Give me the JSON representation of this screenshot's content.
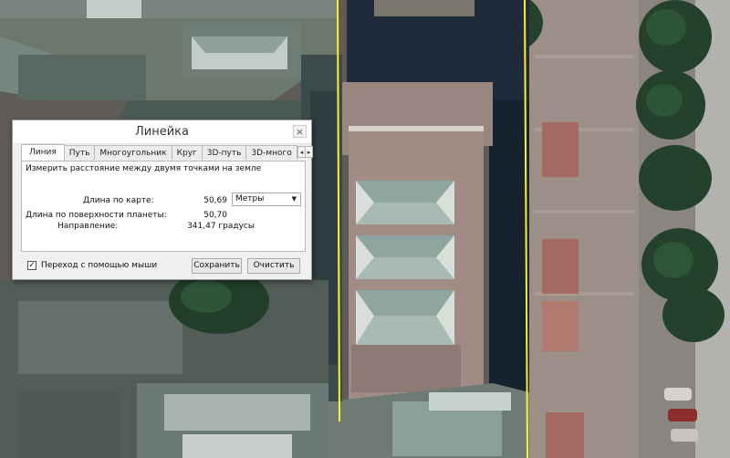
{
  "ruler": {
    "title": "Линейка",
    "close_glyph": "×",
    "tabs": [
      {
        "label": "Линия",
        "active": true
      },
      {
        "label": "Путь"
      },
      {
        "label": "Многоугольник"
      },
      {
        "label": "Круг"
      },
      {
        "label": "3D-путь"
      },
      {
        "label": "3D-много"
      }
    ],
    "tab_scroll_left": "◂",
    "tab_scroll_right": "▸",
    "description": "Измерить расстояние между двумя точками на земле",
    "map_length_label": "Длина по карте:",
    "map_length_value": "50,69",
    "unit_selected": "Метры",
    "ground_length_label": "Длина по поверхности планеты:",
    "ground_length_value": "50,70",
    "heading_label": "Направление:",
    "heading_value": "341,47 градусы",
    "mouse_nav_checked": true,
    "mouse_nav_label": "Переход с помощью мыши",
    "save_label": "Сохранить",
    "clear_label": "Очистить"
  },
  "map": {
    "measure_line_color": "#ffef2a"
  }
}
